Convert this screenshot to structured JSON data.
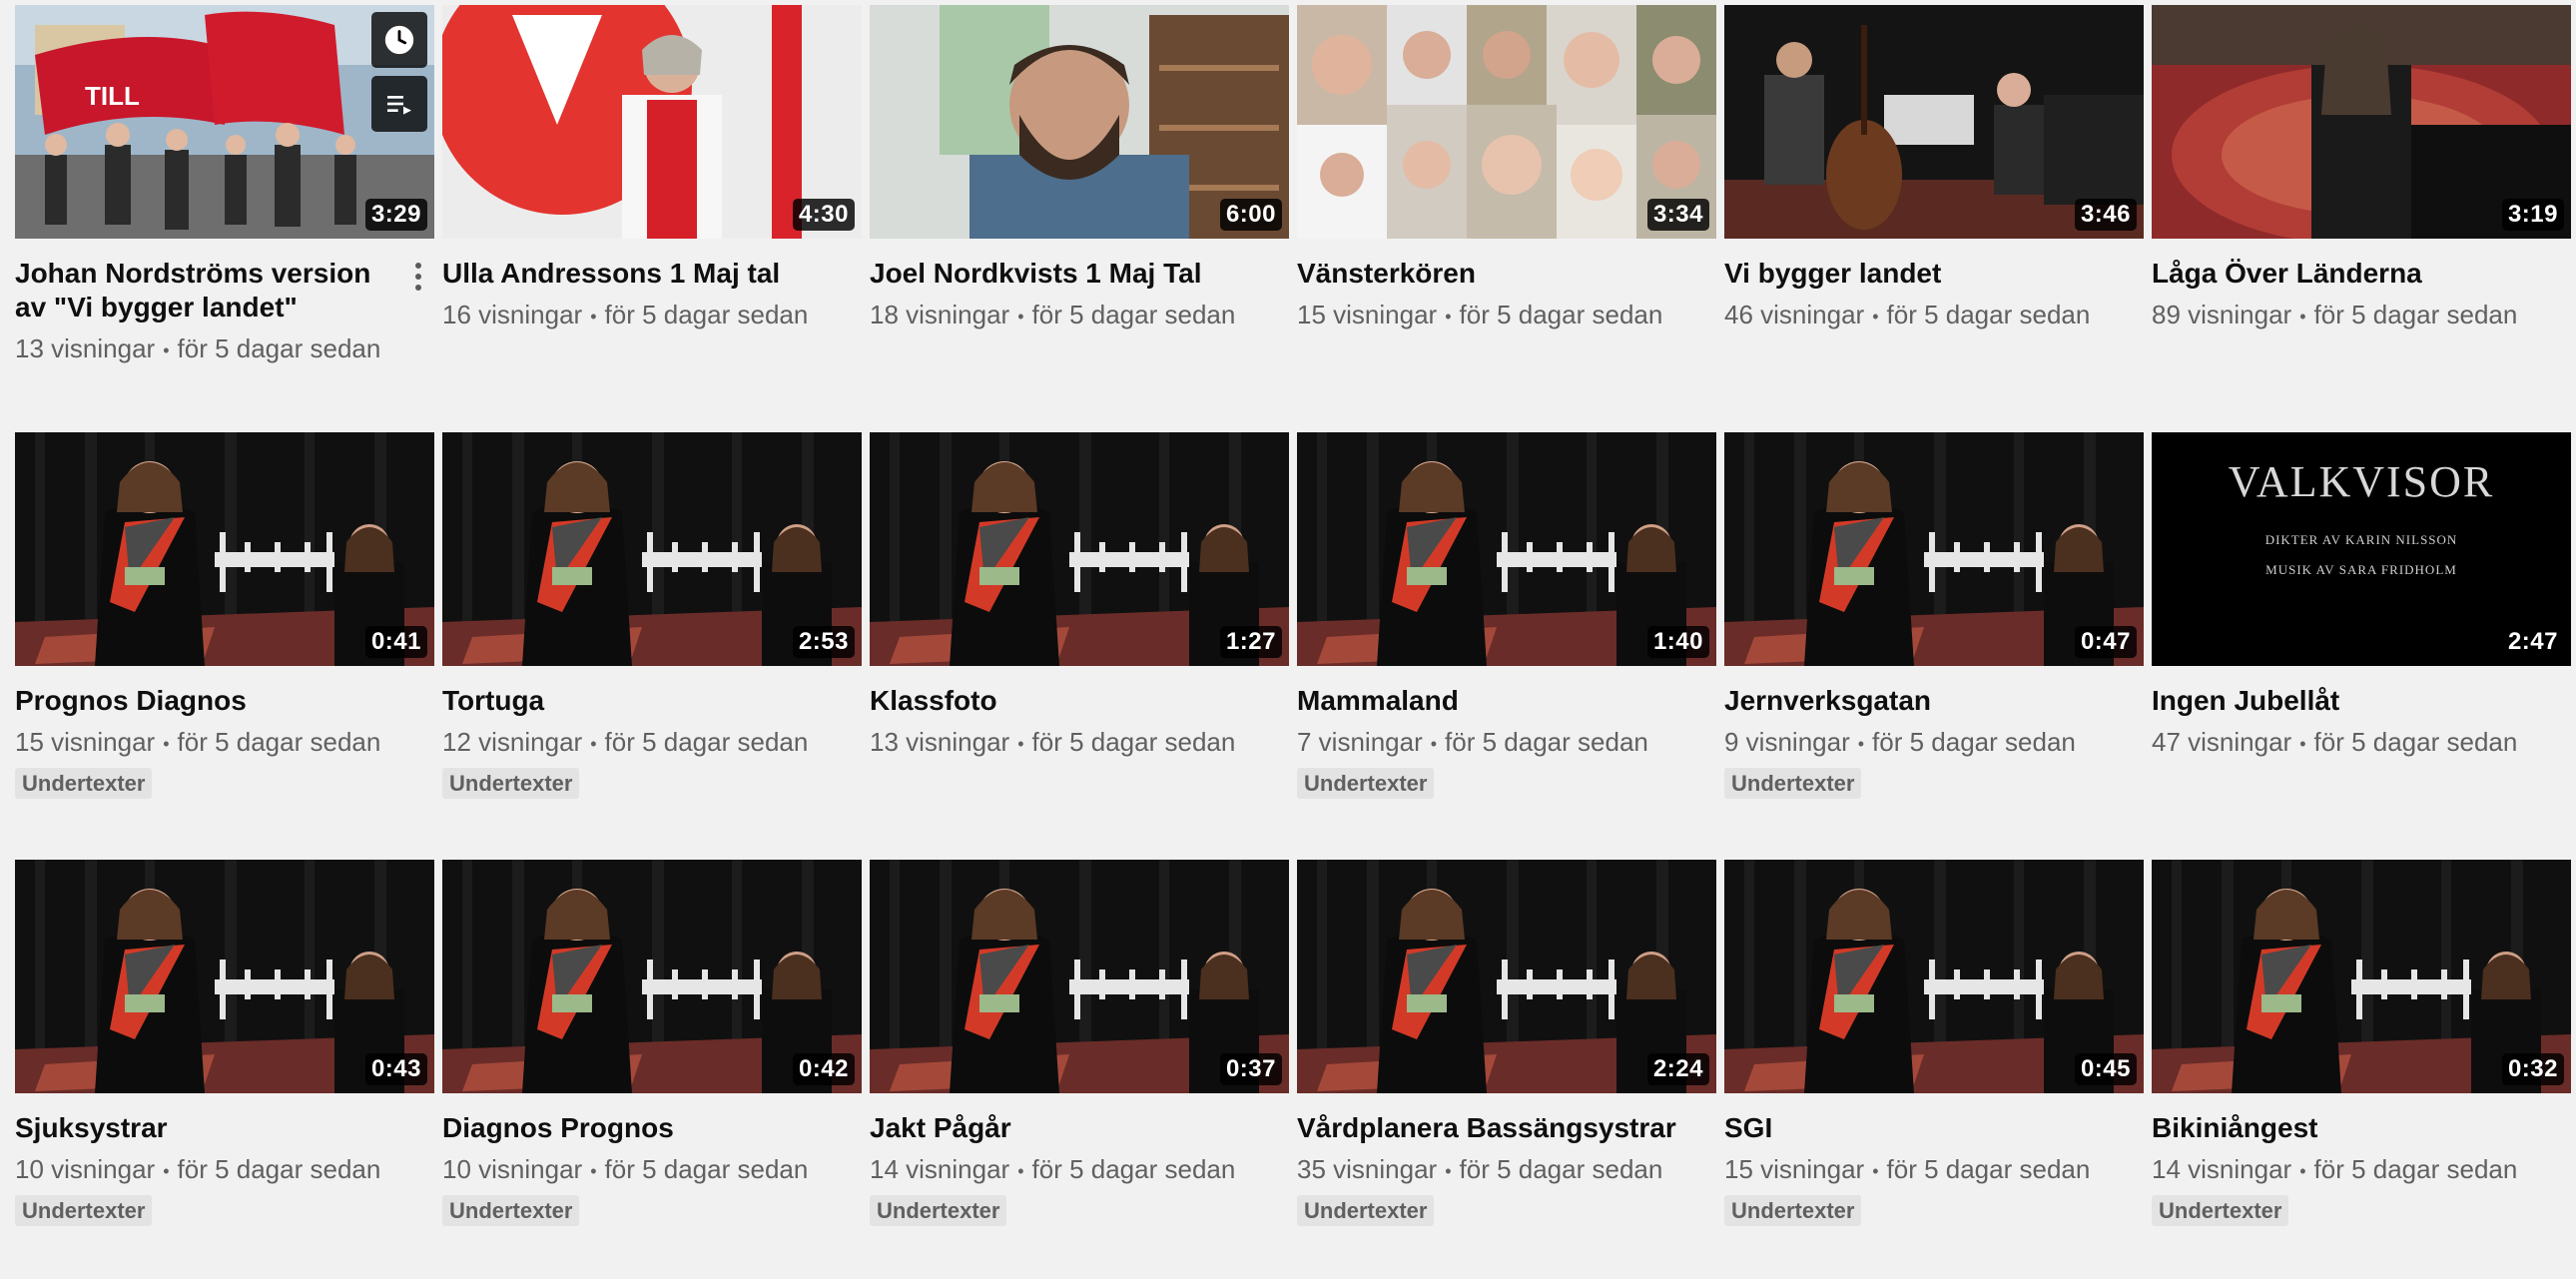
{
  "icons": {
    "watch_later": "clock-icon",
    "add_to_queue": "queue-list-icon",
    "more": "more-vert-icon"
  },
  "videos": [
    {
      "title": "Johan Nordströms version av \"Vi bygger landet\"",
      "views": "13 visningar",
      "age": "för 5 dagar sedan",
      "duration": "3:29",
      "scene": "march",
      "badge": ""
    },
    {
      "title": "Ulla Andressons 1 Maj tal",
      "views": "16 visningar",
      "age": "för 5 dagar sedan",
      "duration": "4:30",
      "scene": "speaker",
      "badge": ""
    },
    {
      "title": "Joel Nordkvists 1 Maj Tal",
      "views": "18 visningar",
      "age": "för 5 dagar sedan",
      "duration": "6:00",
      "scene": "webcam",
      "badge": ""
    },
    {
      "title": "Vänsterkören",
      "views": "15 visningar",
      "age": "för 5 dagar sedan",
      "duration": "3:34",
      "scene": "collage",
      "badge": ""
    },
    {
      "title": "Vi bygger landet",
      "views": "46 visningar",
      "age": "för 5 dagar sedan",
      "duration": "3:46",
      "scene": "bass",
      "badge": ""
    },
    {
      "title": "Låga Över Länderna",
      "views": "89 visningar",
      "age": "för 5 dagar sedan",
      "duration": "3:19",
      "scene": "piano",
      "badge": ""
    },
    {
      "title": "Prognos Diagnos",
      "views": "15 visningar",
      "age": "för 5 dagar sedan",
      "duration": "0:41",
      "scene": "stage",
      "badge": "Undertexter"
    },
    {
      "title": "Tortuga",
      "views": "12 visningar",
      "age": "för 5 dagar sedan",
      "duration": "2:53",
      "scene": "stage",
      "badge": "Undertexter"
    },
    {
      "title": "Klassfoto",
      "views": "13 visningar",
      "age": "för 5 dagar sedan",
      "duration": "1:27",
      "scene": "stage",
      "badge": ""
    },
    {
      "title": "Mammaland",
      "views": "7 visningar",
      "age": "för 5 dagar sedan",
      "duration": "1:40",
      "scene": "stage",
      "badge": "Undertexter"
    },
    {
      "title": "Jernverksgatan",
      "views": "9 visningar",
      "age": "för 5 dagar sedan",
      "duration": "0:47",
      "scene": "stage",
      "badge": "Undertexter"
    },
    {
      "title": "Ingen Jubellåt",
      "views": "47 visningar",
      "age": "för 5 dagar sedan",
      "duration": "2:47",
      "scene": "title-card",
      "badge": ""
    },
    {
      "title": "Sjuksystrar",
      "views": "10 visningar",
      "age": "för 5 dagar sedan",
      "duration": "0:43",
      "scene": "stage",
      "badge": "Undertexter"
    },
    {
      "title": "Diagnos Prognos",
      "views": "10 visningar",
      "age": "för 5 dagar sedan",
      "duration": "0:42",
      "scene": "stage",
      "badge": "Undertexter"
    },
    {
      "title": "Jakt Pågår",
      "views": "14 visningar",
      "age": "för 5 dagar sedan",
      "duration": "0:37",
      "scene": "stage",
      "badge": "Undertexter"
    },
    {
      "title": "Vårdplanera Bassängsystrar",
      "views": "35 visningar",
      "age": "för 5 dagar sedan",
      "duration": "2:24",
      "scene": "stage",
      "badge": "Undertexter"
    },
    {
      "title": "SGI",
      "views": "15 visningar",
      "age": "för 5 dagar sedan",
      "duration": "0:45",
      "scene": "stage",
      "badge": "Undertexter"
    },
    {
      "title": "Bikiniångest",
      "views": "14 visningar",
      "age": "för 5 dagar sedan",
      "duration": "0:32",
      "scene": "stage",
      "badge": "Undertexter"
    }
  ],
  "title_card": {
    "heading": "VALKVISOR",
    "line1": "DIKTER AV KARIN NILSSON",
    "line2": "MUSIK AV SARA FRIDHOLM"
  }
}
